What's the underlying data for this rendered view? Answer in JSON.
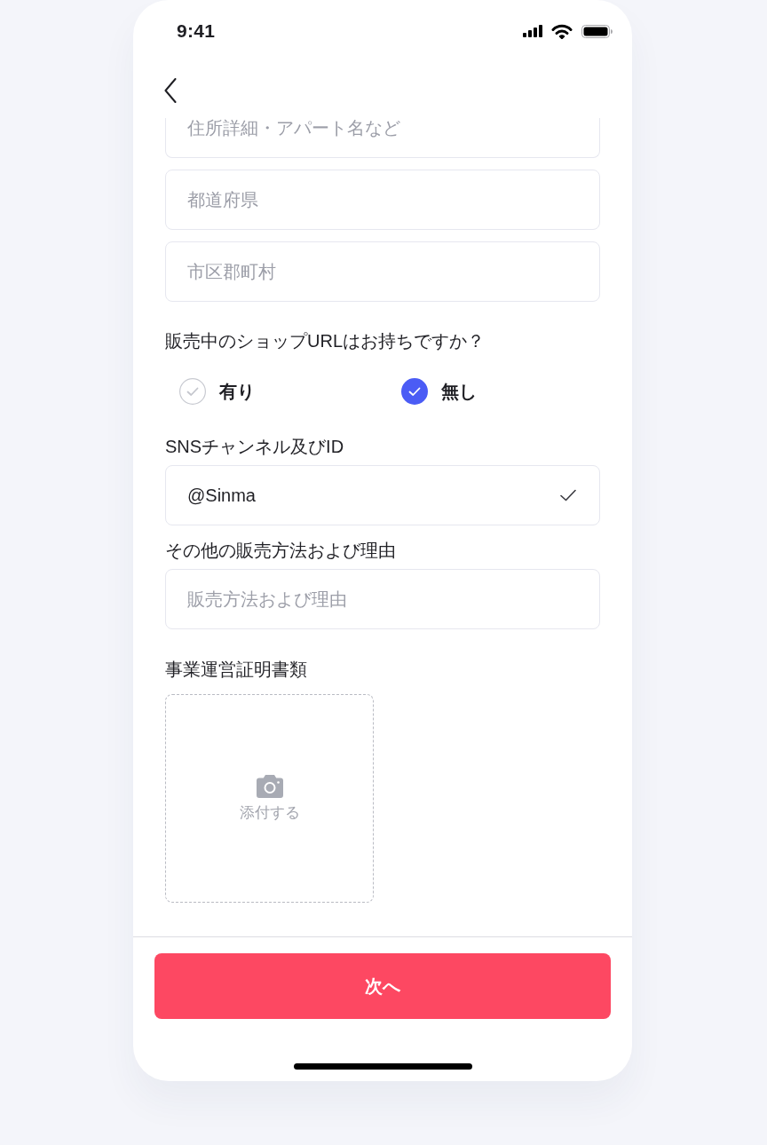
{
  "status_bar": {
    "time": "9:41"
  },
  "address_fields": [
    {
      "placeholder": "住所詳細・アパート名など"
    },
    {
      "placeholder": "都道府県"
    },
    {
      "placeholder": "市区郡町村"
    }
  ],
  "shop_url_question": {
    "label": "販売中のショップURLはお持ちですか？",
    "options": [
      {
        "label": "有り",
        "selected": false
      },
      {
        "label": "無し",
        "selected": true
      }
    ]
  },
  "sns": {
    "label": "SNSチャンネル及びID",
    "value": "@Sinma",
    "valid": true
  },
  "other_methods": {
    "label": "その他の販売方法および理由",
    "placeholder": "販売方法および理由"
  },
  "documents": {
    "label": "事業運営証明書類",
    "upload": {
      "label": "添付する"
    }
  },
  "next_button": {
    "label": "次へ"
  }
}
